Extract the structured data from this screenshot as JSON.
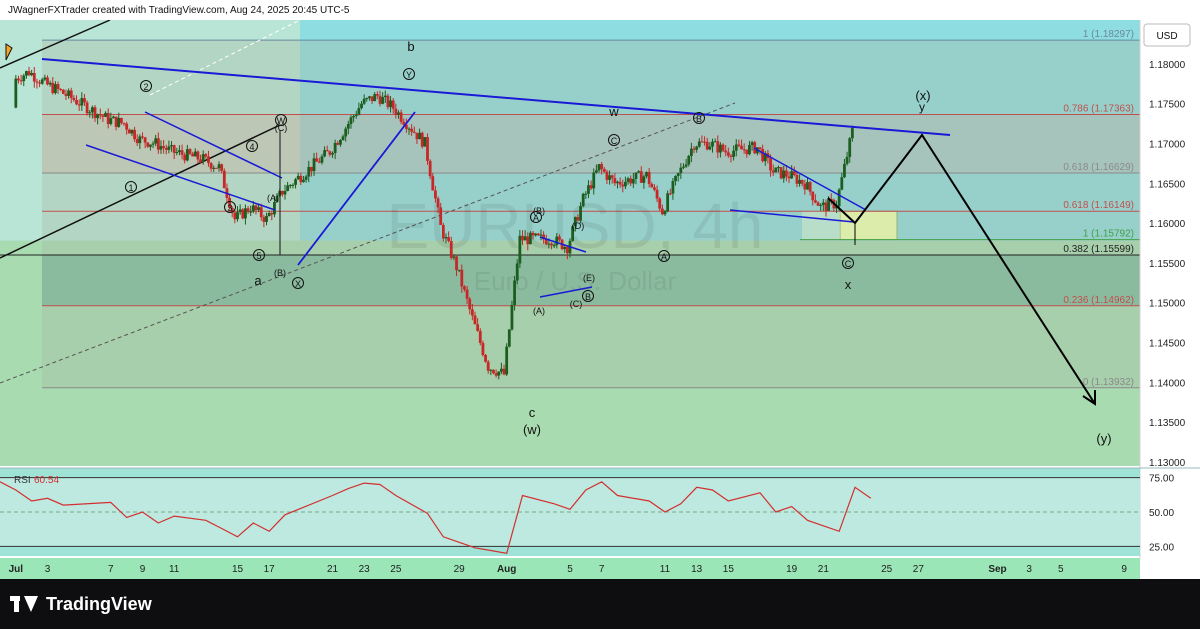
{
  "header": {
    "credit": "JWagnerFXTrader created with TradingView.com, Aug 24, 2025 20:45 UTC-5",
    "currency_button": "USD"
  },
  "watermark": {
    "symbol": "EURUSD, 4h",
    "subtitle": "Euro / U.S. Dollar"
  },
  "footer": {
    "brand": "TradingView"
  },
  "colors": {
    "teal_band": "#8edde0",
    "green_band": "#a8dcb0",
    "zone_fill": "#9fc7aa",
    "bull": "#1b5e20",
    "bear": "#c62828",
    "trendline": "#1a1ad6",
    "rsi_line": "#d32f2f"
  },
  "chart_data": [
    {
      "type": "line",
      "title": "EURUSD, 4h",
      "subtitle": "Euro / U.S. Dollar",
      "xlabel": "",
      "ylabel": "",
      "x_axis": {
        "range": [
          "2025-06-30",
          "2025-09-10"
        ],
        "ticks": [
          {
            "date": "2025-07-01",
            "label": "Jul",
            "bold": true
          },
          {
            "date": "2025-07-03",
            "label": "3"
          },
          {
            "date": "2025-07-07",
            "label": "7"
          },
          {
            "date": "2025-07-09",
            "label": "9"
          },
          {
            "date": "2025-07-11",
            "label": "11"
          },
          {
            "date": "2025-07-15",
            "label": "15"
          },
          {
            "date": "2025-07-17",
            "label": "17"
          },
          {
            "date": "2025-07-21",
            "label": "21"
          },
          {
            "date": "2025-07-23",
            "label": "23"
          },
          {
            "date": "2025-07-25",
            "label": "25"
          },
          {
            "date": "2025-07-29",
            "label": "29"
          },
          {
            "date": "2025-08-01",
            "label": "Aug",
            "bold": true
          },
          {
            "date": "2025-08-05",
            "label": "5"
          },
          {
            "date": "2025-08-07",
            "label": "7"
          },
          {
            "date": "2025-08-11",
            "label": "11"
          },
          {
            "date": "2025-08-13",
            "label": "13"
          },
          {
            "date": "2025-08-15",
            "label": "15"
          },
          {
            "date": "2025-08-19",
            "label": "19"
          },
          {
            "date": "2025-08-21",
            "label": "21"
          },
          {
            "date": "2025-08-25",
            "label": "25"
          },
          {
            "date": "2025-08-27",
            "label": "27"
          },
          {
            "date": "2025-09-01",
            "label": "Sep",
            "bold": true
          },
          {
            "date": "2025-09-03",
            "label": "3"
          },
          {
            "date": "2025-09-05",
            "label": "5"
          },
          {
            "date": "2025-09-09",
            "label": "9"
          }
        ]
      },
      "y_axis": {
        "range": [
          1.1295,
          1.1855
        ],
        "ticks": [
          "1.18000",
          "1.17500",
          "1.17000",
          "1.16500",
          "1.16000",
          "1.15500",
          "1.15000",
          "1.14500",
          "1.14000",
          "1.13500",
          "1.13000"
        ]
      },
      "series": [
        {
          "values_close": [
            [
              "2025-07-01",
              1.178
            ],
            [
              "2025-07-02",
              1.179
            ],
            [
              "2025-07-03",
              1.1775
            ],
            [
              "2025-07-04",
              1.1765
            ],
            [
              "2025-07-07",
              1.173
            ],
            [
              "2025-07-08",
              1.1725
            ],
            [
              "2025-07-09",
              1.1705
            ],
            [
              "2025-07-10",
              1.17
            ],
            [
              "2025-07-11",
              1.169
            ],
            [
              "2025-07-13",
              1.168
            ],
            [
              "2025-07-14",
              1.167
            ],
            [
              "2025-07-15",
              1.1605
            ],
            [
              "2025-07-16",
              1.162
            ],
            [
              "2025-07-17",
              1.1605
            ],
            [
              "2025-07-18",
              1.164
            ],
            [
              "2025-07-21",
              1.169
            ],
            [
              "2025-07-22",
              1.172
            ],
            [
              "2025-07-23",
              1.175
            ],
            [
              "2025-07-24",
              1.176
            ],
            [
              "2025-07-25",
              1.1745
            ],
            [
              "2025-07-27",
              1.17
            ],
            [
              "2025-07-28",
              1.1595
            ],
            [
              "2025-07-29",
              1.1545
            ],
            [
              "2025-07-30",
              1.148
            ],
            [
              "2025-07-31",
              1.142
            ],
            [
              "2025-08-01",
              1.141
            ],
            [
              "2025-08-02",
              1.158
            ],
            [
              "2025-08-04",
              1.158
            ],
            [
              "2025-08-05",
              1.157
            ],
            [
              "2025-08-06",
              1.163
            ],
            [
              "2025-08-07",
              1.167
            ],
            [
              "2025-08-08",
              1.165
            ],
            [
              "2025-08-10",
              1.166
            ],
            [
              "2025-08-11",
              1.1615
            ],
            [
              "2025-08-12",
              1.166
            ],
            [
              "2025-08-13",
              1.17
            ],
            [
              "2025-08-14",
              1.17
            ],
            [
              "2025-08-15",
              1.169
            ],
            [
              "2025-08-17",
              1.1695
            ],
            [
              "2025-08-18",
              1.1665
            ],
            [
              "2025-08-19",
              1.166
            ],
            [
              "2025-08-20",
              1.165
            ],
            [
              "2025-08-21",
              1.162
            ],
            [
              "2025-08-22",
              1.1625
            ],
            [
              "2025-08-23",
              1.1715
            ]
          ]
        }
      ],
      "fibonacci_levels": [
        {
          "ratio": "1",
          "price": 1.18297,
          "label": "1 (1.18297)"
        },
        {
          "ratio": "0.786",
          "price": 1.17363,
          "label": "0.786 (1.17363)"
        },
        {
          "ratio": "0.618",
          "price": 1.16629,
          "label": "0.618 (1.16629)"
        },
        {
          "ratio": "0.618",
          "price": 1.16149,
          "label": "0.618 (1.16149)"
        },
        {
          "ratio": "1",
          "price": 1.15792,
          "label": "1 (1.15792)"
        },
        {
          "ratio": "0.382",
          "price": 1.15599,
          "label": "0.382 (1.15599)"
        },
        {
          "ratio": "0.236",
          "price": 1.14962,
          "label": "0.236 (1.14962)"
        },
        {
          "ratio": "0",
          "price": 1.13932,
          "label": "0 (1.13932)"
        }
      ],
      "wave_labels": [
        "b",
        "c",
        "(w)",
        "w",
        "x",
        "(x)",
        "y",
        "(y)",
        "a",
        "1",
        "2",
        "3",
        "4",
        "5",
        "A",
        "B",
        "C",
        "D",
        "E",
        "W",
        "X",
        "Y"
      ]
    },
    {
      "type": "line",
      "title": "RSI",
      "current_value_label": "60.54",
      "y_axis": {
        "range": [
          18,
          82
        ],
        "ticks": [
          "75.00",
          "50.00",
          "25.00"
        ]
      },
      "series": [
        {
          "values": [
            [
              "2025-06-30",
              72
            ],
            [
              "2025-07-01",
              66
            ],
            [
              "2025-07-02",
              58
            ],
            [
              "2025-07-03",
              60
            ],
            [
              "2025-07-04",
              55
            ],
            [
              "2025-07-07",
              57
            ],
            [
              "2025-07-08",
              46
            ],
            [
              "2025-07-09",
              50
            ],
            [
              "2025-07-10",
              42
            ],
            [
              "2025-07-11",
              47
            ],
            [
              "2025-07-13",
              44
            ],
            [
              "2025-07-14",
              38
            ],
            [
              "2025-07-15",
              32
            ],
            [
              "2025-07-16",
              42
            ],
            [
              "2025-07-17",
              36
            ],
            [
              "2025-07-18",
              48
            ],
            [
              "2025-07-21",
              62
            ],
            [
              "2025-07-22",
              67
            ],
            [
              "2025-07-23",
              71
            ],
            [
              "2025-07-24",
              70
            ],
            [
              "2025-07-25",
              62
            ],
            [
              "2025-07-27",
              49
            ],
            [
              "2025-07-28",
              32
            ],
            [
              "2025-07-29",
              28
            ],
            [
              "2025-07-30",
              24
            ],
            [
              "2025-07-31",
              22
            ],
            [
              "2025-08-01",
              20
            ],
            [
              "2025-08-02",
              62
            ],
            [
              "2025-08-04",
              56
            ],
            [
              "2025-08-05",
              52
            ],
            [
              "2025-08-06",
              66
            ],
            [
              "2025-08-07",
              72
            ],
            [
              "2025-08-08",
              62
            ],
            [
              "2025-08-10",
              58
            ],
            [
              "2025-08-11",
              50
            ],
            [
              "2025-08-12",
              56
            ],
            [
              "2025-08-13",
              68
            ],
            [
              "2025-08-14",
              66
            ],
            [
              "2025-08-15",
              58
            ],
            [
              "2025-08-17",
              64
            ],
            [
              "2025-08-18",
              50
            ],
            [
              "2025-08-19",
              54
            ],
            [
              "2025-08-20",
              44
            ],
            [
              "2025-08-21",
              40
            ],
            [
              "2025-08-22",
              36
            ],
            [
              "2025-08-23",
              68
            ],
            [
              "2025-08-24",
              60
            ]
          ]
        }
      ]
    }
  ]
}
